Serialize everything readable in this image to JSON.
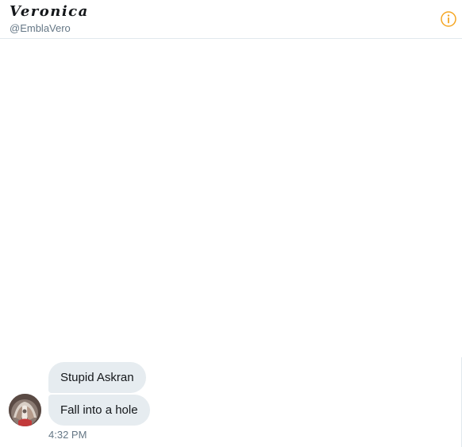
{
  "header": {
    "display_name": "Veronica",
    "handle": "@EmblaVero",
    "info_icon": "info-circle-icon",
    "accent_color": "#f5a623"
  },
  "messages": [
    {
      "text": "Stupid Askran"
    },
    {
      "text": "Fall into a hole"
    }
  ],
  "timestamp": "4:32 PM",
  "colors": {
    "bubble_background": "#e6ecf0",
    "secondary_text": "#657786",
    "divider": "#e1e8ed"
  }
}
